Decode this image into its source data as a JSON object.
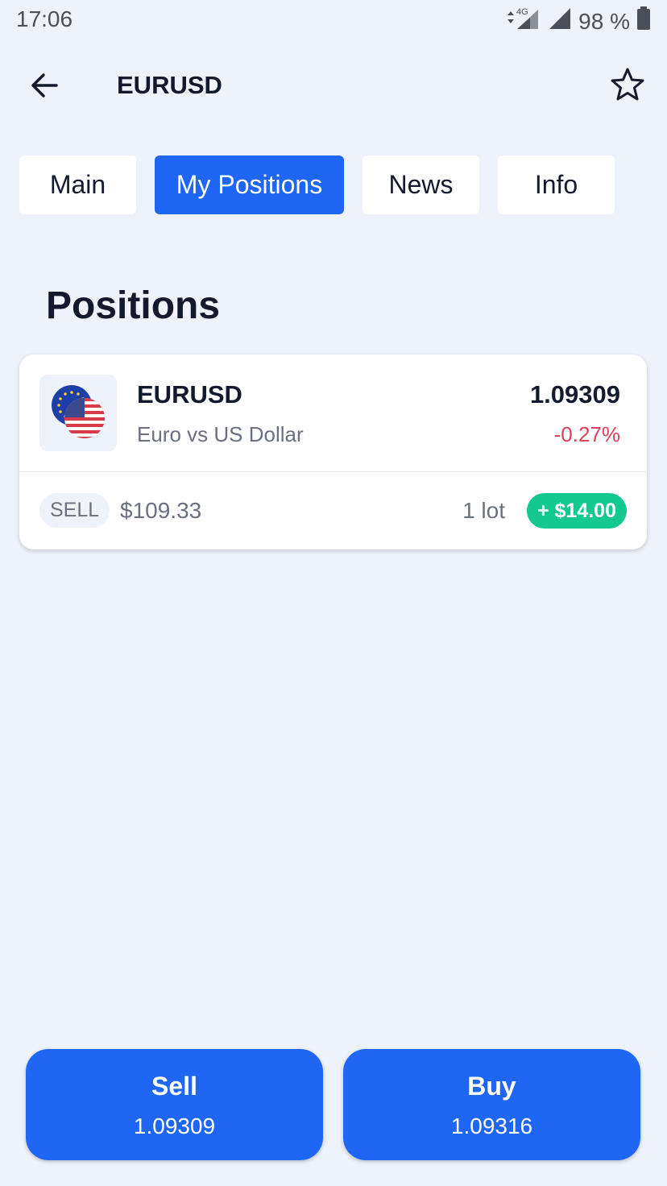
{
  "status_bar": {
    "time": "17:06",
    "network": "4G",
    "battery": "98 %"
  },
  "header": {
    "title": "EURUSD"
  },
  "tabs": [
    {
      "label": "Main",
      "active": false
    },
    {
      "label": "My Positions",
      "active": true
    },
    {
      "label": "News",
      "active": false
    },
    {
      "label": "Info",
      "active": false
    }
  ],
  "section": {
    "title": "Positions"
  },
  "position": {
    "symbol": "EURUSD",
    "description": "Euro vs US Dollar",
    "price": "1.09309",
    "change": "-0.27%",
    "side": "SELL",
    "amount": "$109.33",
    "lot": "1 lot",
    "pnl": "+ $14.00"
  },
  "actions": {
    "sell": {
      "label": "Sell",
      "price": "1.09309"
    },
    "buy": {
      "label": "Buy",
      "price": "1.09316"
    }
  },
  "colors": {
    "accent": "#1f66f5",
    "negative": "#e0405a",
    "positive": "#13c98f",
    "background": "#eef2fa"
  }
}
